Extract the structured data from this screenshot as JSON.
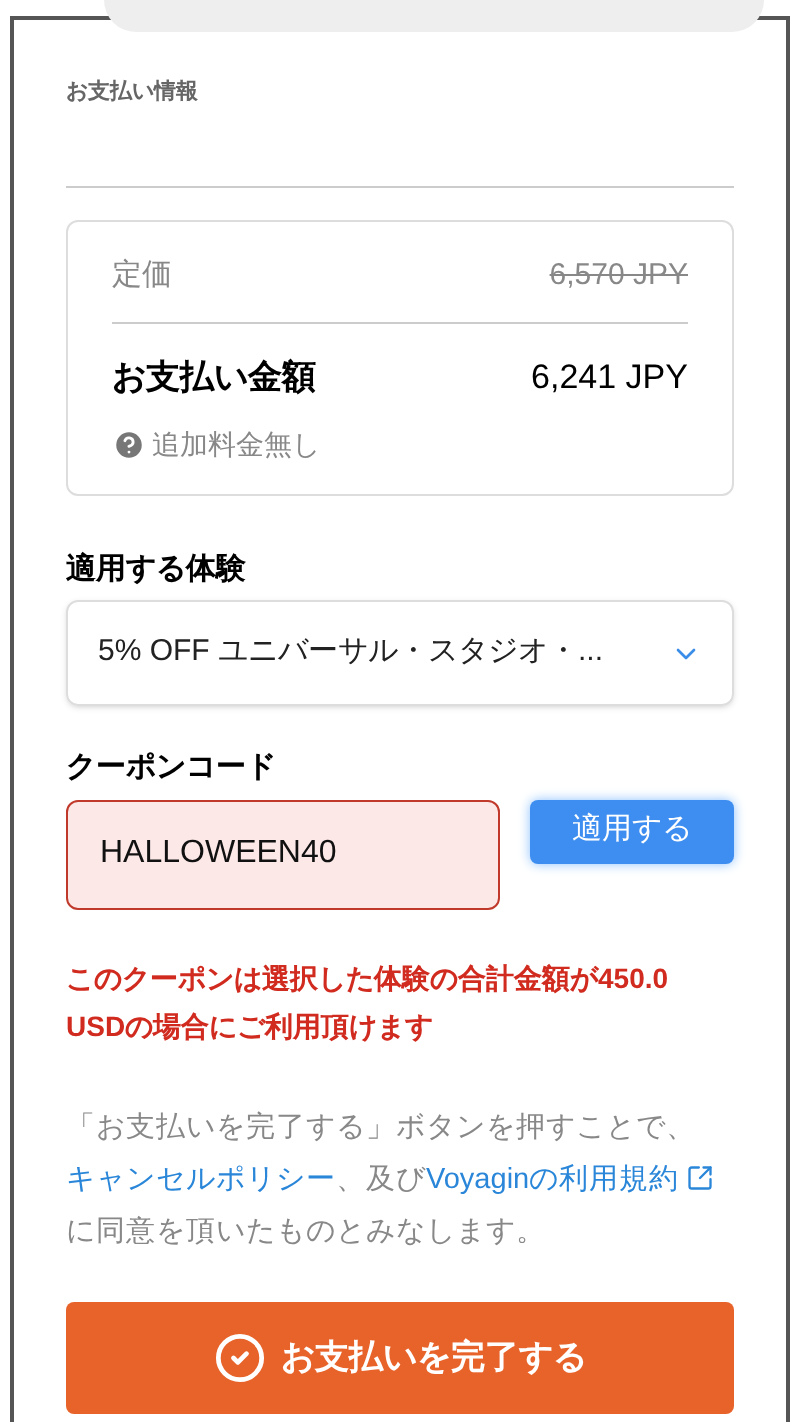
{
  "section_title": "お支払い情報",
  "summary": {
    "list_price_label": "定価",
    "list_price": "6,570 JPY",
    "total_label": "お支払い金額",
    "total": "6,241 JPY",
    "note": "追加料金無し"
  },
  "experience": {
    "label": "適用する体験",
    "value": "5% OFF ユニバーサル・スタジオ・..."
  },
  "coupon": {
    "label": "クーポンコード",
    "value": "HALLOWEEN40",
    "error": true,
    "apply_button": "適用する",
    "error_message": "このクーポンは選択した体験の合計金額が450.0 USDの場合にご利用頂けます"
  },
  "terms": {
    "prefix": "「お支払いを完了する」ボタンを押すことで、",
    "link_1": "キャンセルポリシー",
    "middle": "、及び",
    "link_2": "Voyaginの利用規約",
    "suffix": "に同意を頂いたものとみなします。"
  },
  "pay_button": "お支払いを完了する"
}
